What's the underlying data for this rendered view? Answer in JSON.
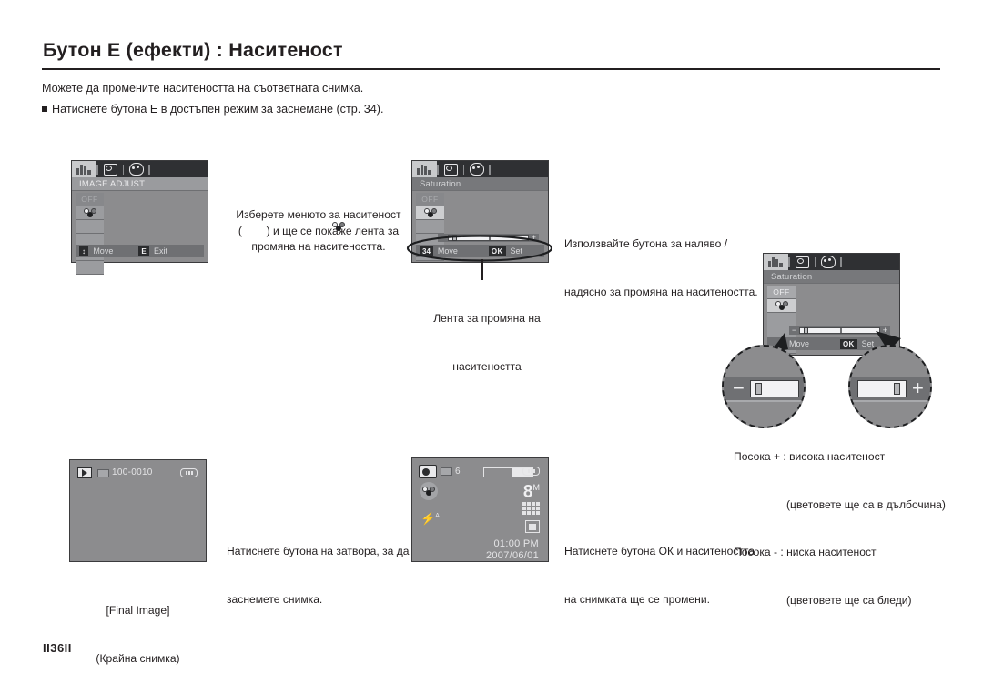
{
  "header": {
    "title": "Бутон E (ефекти) : Наситеност",
    "intro_1": "Можете да промените наситеността на съответната снимка.",
    "intro_2": "Натиснете бутона E в достъпен режим за заснемане (стр. 34)."
  },
  "screen1": {
    "heading": "IMAGE ADJUST",
    "menu_off": "OFF",
    "move_key": "↕",
    "move_label": "Move",
    "exit_key": "E",
    "exit_label": "Exit"
  },
  "screen2": {
    "heading": "Saturation",
    "menu_off": "OFF",
    "minus": "−",
    "plus": "+",
    "move_key": "34",
    "move_label": "Move",
    "set_key": "OK",
    "set_label": "Set"
  },
  "screen3": {
    "heading": "Saturation",
    "menu_off": "OFF",
    "minus": "−",
    "plus": "+",
    "move_label": "Move",
    "set_key": "OK",
    "set_label": "Set"
  },
  "bubbles": {
    "minus_sign": "−",
    "plus_sign": "+"
  },
  "captions": {
    "select_menu": "Изберете менюто за наситеност\n(      ) и ще се покаже лента за\nпромяна на наситеността.",
    "select_menu_l1": "Изберете менюто за наситеност",
    "select_menu_l2_pre": "(",
    "select_menu_l2_post": ") и ще се покаже лента за",
    "select_menu_l3": "промяна на наситеността.",
    "slider_label_l1": "Лента за промяна на",
    "slider_label_l2": "наситеността",
    "use_buttons_l1": "Използвайте бутона за наляво /",
    "use_buttons_l2": "надясно за промяна на наситеността.",
    "direction_l1": "Посока + : висока наситеност",
    "direction_l2": "(цветовете ще са в дълбочина)",
    "direction_l3": "Посока - : ниска наситеност",
    "direction_l4": "(цветовете ще са бледи)",
    "shutter_l1": "Натиснете бутона на затвора, за да",
    "shutter_l2": "заснемете снимка.",
    "ok_l1": "Натиснете бутона ОК и наситеността",
    "ok_l2": "на снимката ще се промени.",
    "final_image_l1": "[Final Image]",
    "final_image_l2": "(Крайна снимка)"
  },
  "playback_screen": {
    "file_number": "100-0010"
  },
  "capture_screen": {
    "ev_label": "6",
    "resolution": "8",
    "resolution_sup": "M",
    "time": "01:00 PM",
    "date": "2007/06/01"
  },
  "footer": {
    "page_number": "II36II"
  },
  "colors": {
    "text": "#231f20",
    "lcd_background": "#8c8c8e",
    "lcd_bar": "#6f7073",
    "lcd_tabbar": "#2f3033"
  }
}
